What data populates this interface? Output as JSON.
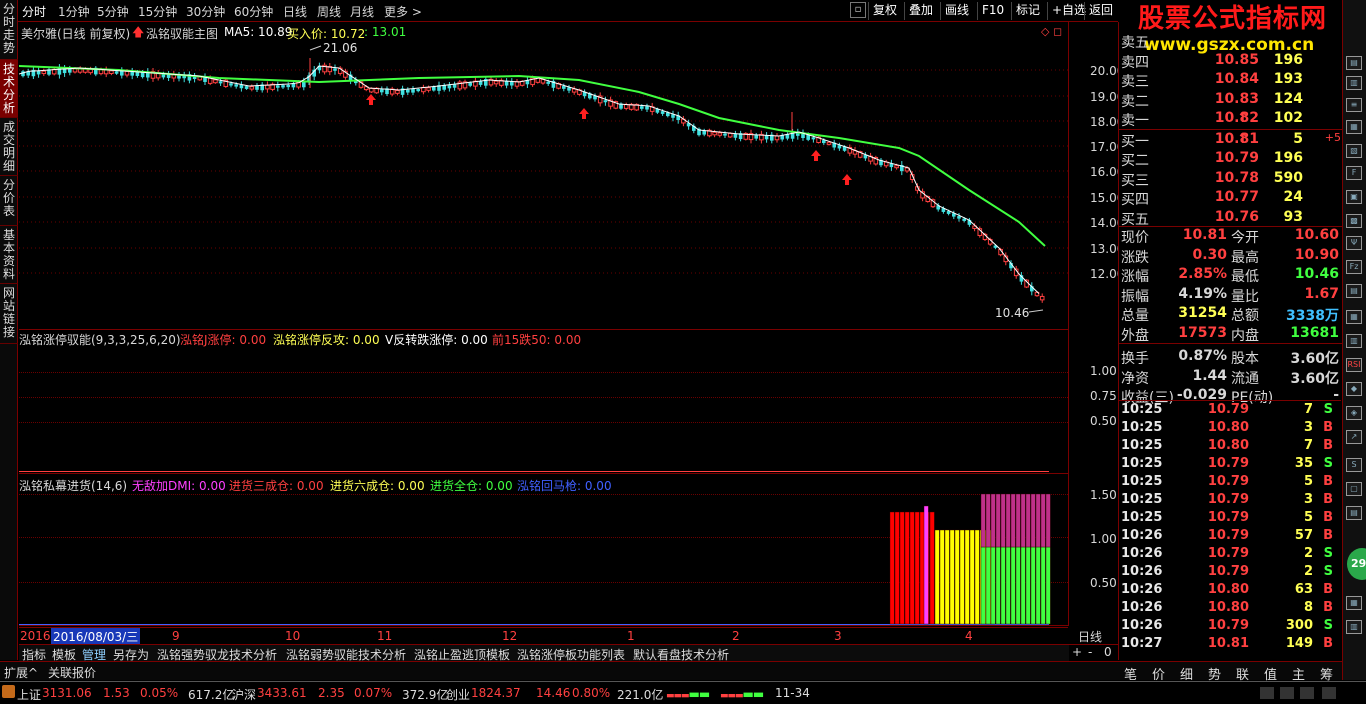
{
  "toolbar": {
    "periods": [
      "分时",
      "1分钟",
      "5分钟",
      "15分钟",
      "30分钟",
      "60分钟",
      "日线",
      "周线",
      "月线",
      "更多 >"
    ],
    "right_buttons": [
      "复权",
      "叠加",
      "画线",
      "F10",
      "标记",
      "+自选",
      "返回"
    ]
  },
  "left_tabs": [
    "分时走势",
    "技术分析",
    "成交明细",
    "分价表",
    "基本资料",
    "网站链接"
  ],
  "main_chart": {
    "title_stock": "美尔雅(日线 前复权)",
    "title_indicator": "泓铭驭能主图",
    "ma5_label": "MA5: 10.89",
    "buy_label": "买入价: 10.72",
    "buy_value2": ": 13.01",
    "high_annotation": "21.06",
    "low_annotation": "10.46",
    "y_ticks": [
      "20.00",
      "19.00",
      "18.00",
      "17.00",
      "16.00",
      "15.00",
      "14.00",
      "13.00",
      "12.00"
    ]
  },
  "indicator1": {
    "title": "泓铭涨停驭能(9,3,3,25,6,20)",
    "items": [
      {
        "label": "泓铭J涨停: 0.00",
        "color": "#ff4040"
      },
      {
        "label": "泓铭涨停反攻: 0.00",
        "color": "#ffff55"
      },
      {
        "label": "V反转跌涨停: 0.00",
        "color": "#ffffff"
      },
      {
        "label": "前15跌50: 0.00",
        "color": "#ff4040"
      }
    ],
    "y_ticks": [
      "1.00",
      "0.75",
      "0.50"
    ]
  },
  "indicator2": {
    "title": "泓铭私幕进货(14,6)",
    "items": [
      {
        "label": "无敌加DMI: 0.00",
        "color": "#ff40ff"
      },
      {
        "label": "进货三成仓: 0.00",
        "color": "#ff4040"
      },
      {
        "label": "进货六成仓: 0.00",
        "color": "#ffff55"
      },
      {
        "label": "进货全仓: 0.00",
        "color": "#40ff40"
      },
      {
        "label": "泓铭回马枪: 0.00",
        "color": "#4060ff"
      }
    ],
    "y_ticks": [
      "1.50",
      "1.00",
      "0.50"
    ]
  },
  "x_axis": {
    "labels": [
      "2016",
      "2016/08/03/三",
      "9",
      "10",
      "11",
      "12",
      "1",
      "2",
      "3",
      "4"
    ],
    "period": "日线",
    "controls": [
      "+",
      "-",
      "0"
    ]
  },
  "template_tabs": [
    "指标",
    "模板",
    "管理",
    "另存为",
    "泓铭强势驭龙技术分析",
    "泓铭弱势驭能技术分析",
    "泓铭止盈逃顶模板",
    "泓铭涨停板功能列表",
    "默认看盘技术分析"
  ],
  "ext_bar": [
    "扩展^",
    "关联报价"
  ],
  "watermark": {
    "line1": "股票公式指标网",
    "line2": "www.gszx.com.cn"
  },
  "order_book": {
    "sells": [
      {
        "label": "卖五",
        "price": "",
        "vol": ""
      },
      {
        "label": "卖四",
        "price": "10.85",
        "vol": "196"
      },
      {
        "label": "卖三",
        "price": "10.84",
        "vol": "193"
      },
      {
        "label": "卖二",
        "price": "10.83",
        "vol": "124"
      },
      {
        "label": "卖一",
        "price": "10.82",
        "vol": "102",
        "arrow": "↑"
      }
    ],
    "buys": [
      {
        "label": "买一",
        "price": "10.81",
        "vol": "5",
        "arrow": "↑",
        "extra": "+5"
      },
      {
        "label": "买二",
        "price": "10.79",
        "vol": "196"
      },
      {
        "label": "买三",
        "price": "10.78",
        "vol": "590"
      },
      {
        "label": "买四",
        "price": "10.77",
        "vol": "24"
      },
      {
        "label": "买五",
        "price": "10.76",
        "vol": "93"
      }
    ]
  },
  "summary": [
    {
      "l1": "现价",
      "v1": "10.81",
      "c1": "#ff4040",
      "l2": "今开",
      "v2": "10.60",
      "c2": "#ff4040"
    },
    {
      "l1": "涨跌",
      "v1": "0.30",
      "c1": "#ff4040",
      "l2": "最高",
      "v2": "10.90",
      "c2": "#ff4040"
    },
    {
      "l1": "涨幅",
      "v1": "2.85%",
      "c1": "#ff4040",
      "l2": "最低",
      "v2": "10.46",
      "c2": "#40ff40"
    },
    {
      "l1": "振幅",
      "v1": "4.19%",
      "c1": "#d8d8d8",
      "l2": "量比",
      "v2": "1.67",
      "c2": "#ff4040"
    },
    {
      "l1": "总量",
      "v1": "31254",
      "c1": "#ffff55",
      "l2": "总额",
      "v2": "3338万",
      "c2": "#40c0ff"
    },
    {
      "l1": "外盘",
      "v1": "17573",
      "c1": "#ff4040",
      "l2": "内盘",
      "v2": "13681",
      "c2": "#40ff40"
    },
    {
      "l1": "换手",
      "v1": "0.87%",
      "c1": "#d8d8d8",
      "l2": "股本",
      "v2": "3.60亿",
      "c2": "#d8d8d8"
    },
    {
      "l1": "净资",
      "v1": "1.44",
      "c1": "#d8d8d8",
      "l2": "流通",
      "v2": "3.60亿",
      "c2": "#d8d8d8"
    },
    {
      "l1": "收益(三)",
      "v1": "-0.029",
      "c1": "#d8d8d8",
      "l2": "PE(动)",
      "v2": "-",
      "c2": "#d8d8d8"
    }
  ],
  "ticks": [
    {
      "time": "10:25",
      "price": "10.79",
      "vol": "7",
      "side": "S"
    },
    {
      "time": "10:25",
      "price": "10.80",
      "vol": "3",
      "side": "B"
    },
    {
      "time": "10:25",
      "price": "10.80",
      "vol": "7",
      "side": "B"
    },
    {
      "time": "10:25",
      "price": "10.79",
      "vol": "35",
      "side": "S"
    },
    {
      "time": "10:25",
      "price": "10.79",
      "vol": "5",
      "side": "B"
    },
    {
      "time": "10:25",
      "price": "10.79",
      "vol": "3",
      "side": "B"
    },
    {
      "time": "10:25",
      "price": "10.79",
      "vol": "5",
      "side": "B"
    },
    {
      "time": "10:26",
      "price": "10.79",
      "vol": "57",
      "side": "B"
    },
    {
      "time": "10:26",
      "price": "10.79",
      "vol": "2",
      "side": "S"
    },
    {
      "time": "10:26",
      "price": "10.79",
      "vol": "2",
      "side": "S"
    },
    {
      "time": "10:26",
      "price": "10.80",
      "vol": "63",
      "side": "B"
    },
    {
      "time": "10:26",
      "price": "10.80",
      "vol": "8",
      "side": "B"
    },
    {
      "time": "10:26",
      "price": "10.79",
      "vol": "300",
      "side": "S"
    },
    {
      "time": "10:27",
      "price": "10.81",
      "vol": "149",
      "side": "B"
    }
  ],
  "bottom_right_tabs": [
    "笔",
    "价",
    "细",
    "势",
    "联",
    "值",
    "主",
    "筹"
  ],
  "status": {
    "sh_label": "上证",
    "sh_val": "3131.06",
    "sh_chg": "1.53",
    "sh_pct": "0.05%",
    "sh_amt": "617.2亿",
    "hs_label": "沪深",
    "hs_val": "3433.61",
    "hs_chg": "2.35",
    "hs_pct": "0.07%",
    "hs_amt": "372.9亿",
    "cy_label": "创业",
    "cy_val": "1824.37",
    "cy_chg": "14.46",
    "cy_pct": "0.80%",
    "cy_amt": "221.0亿",
    "time": "11-34"
  },
  "colors": {
    "up": "#ff4040",
    "down": "#40ff40",
    "ma": "#40ff40",
    "grid": "#7a0000",
    "candle_up": "#ff4040",
    "candle_down": "#40ffff"
  },
  "right_icons": [
    "chart-icon",
    "list-icon",
    "f10-icon",
    "news-icon",
    "rsi-icon",
    "diamond-icon",
    "grid-icon",
    "circle-badge-icon"
  ]
}
